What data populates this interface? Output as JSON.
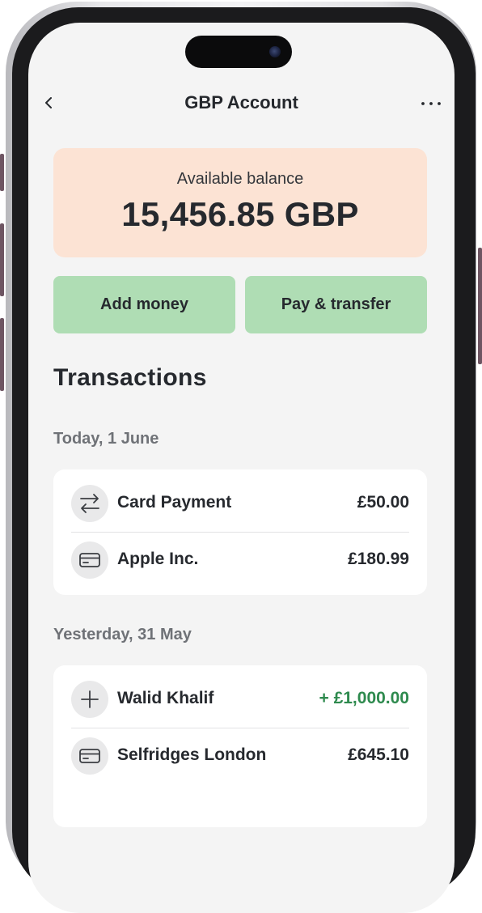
{
  "header": {
    "title": "GBP Account",
    "back_icon": "chevron-left-icon",
    "more_icon": "more-horizontal-icon"
  },
  "balance": {
    "label": "Available balance",
    "amount": "15,456.85 GBP",
    "card_color": "#fce3d4"
  },
  "actions": {
    "add_money": "Add money",
    "pay_transfer": "Pay & transfer",
    "button_color": "#afddb4"
  },
  "transactions": {
    "title": "Transactions",
    "groups": [
      {
        "date": "Today, 1 June",
        "items": [
          {
            "name": "Card Payment",
            "amount": "£50.00",
            "icon": "transfer-arrows-icon",
            "type": "debit"
          },
          {
            "name": "Apple Inc.",
            "amount": "£180.99",
            "icon": "credit-card-icon",
            "type": "debit"
          }
        ]
      },
      {
        "date": "Yesterday, 31 May",
        "items": [
          {
            "name": "Walid Khalif",
            "amount": "+ £1,000.00",
            "icon": "plus-icon",
            "type": "credit"
          },
          {
            "name": "Selfridges London",
            "amount": "£645.10",
            "icon": "credit-card-icon",
            "type": "debit"
          }
        ]
      }
    ]
  },
  "colors": {
    "credit": "#2e8a4e",
    "screen_bg": "#f4f4f4"
  }
}
